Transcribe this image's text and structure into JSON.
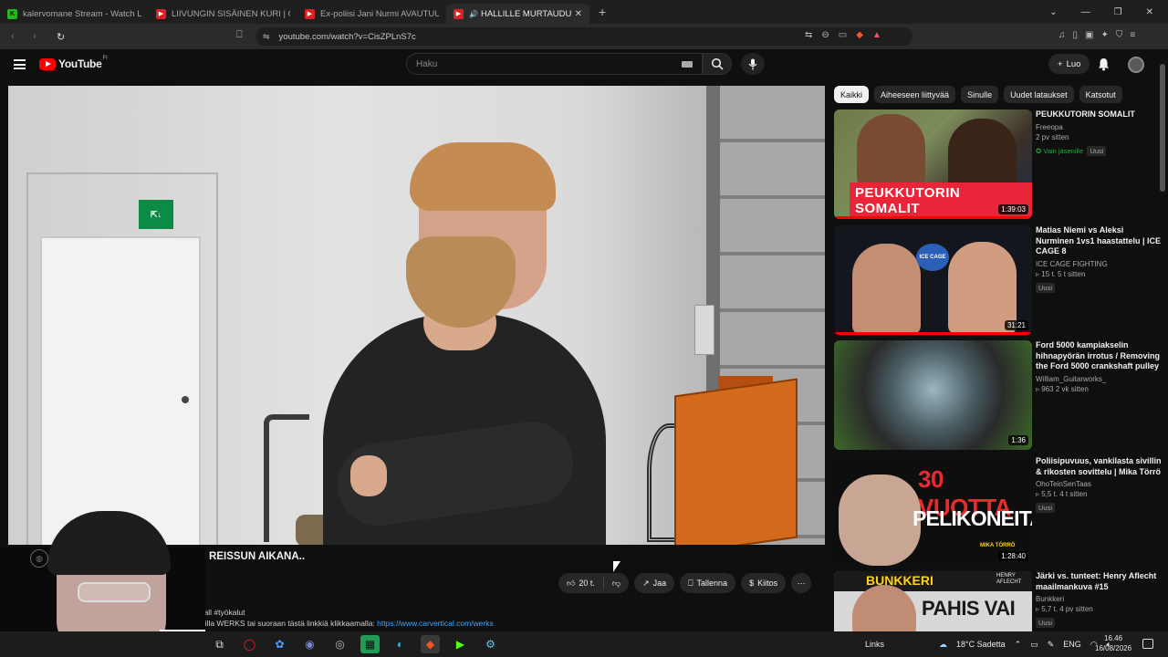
{
  "browser": {
    "tabs": [
      {
        "title": "kalervomane Stream - Watch Live on",
        "favicon": "kick"
      },
      {
        "title": "LIIVUNGIN SISÄINEN KURI | CANNO",
        "favicon": "youtube"
      },
      {
        "title": "Ex-poliisi Jani Nurmi AVAUTUU rikolli",
        "favicon": "youtube"
      },
      {
        "title": "HALLILLE MURTAUDUTTIIN I",
        "favicon": "youtube",
        "active": true,
        "audio": "speaker-icon"
      }
    ],
    "url": "youtube.com/watch?v=CisZPLnS7c"
  },
  "youtube": {
    "logo": "YouTube",
    "country": "FI",
    "search_placeholder": "Haku",
    "create_label": "Luo",
    "video_title": "..LANNIN REISSUN AIKANA..",
    "actions": {
      "likes": "20 t.",
      "share": "Jaa",
      "save": "Tallenna",
      "thanks": "Kiitos"
    },
    "description_line1": "aelWerka #hall #työkalut",
    "description_line2": "orteista koodilla WERKS tai suoraan tästä linkkiä klikkaamalla: ",
    "description_link": "https://www.carvertical.com/werks"
  },
  "chips": [
    "Kaikki",
    "Aiheeseen liittyvää",
    "Sinulle",
    "Uudet lataukset",
    "Katsotut"
  ],
  "recommendations": [
    {
      "title": "PEUKKUTORIN SOMALIT",
      "channel": "Freeopa",
      "views": "2 pv sitten",
      "members": "Vain jäsenille",
      "badge": "Uusi",
      "duration": "1:39:03",
      "thumb_text": "PEUKKUTORIN SOMALIT",
      "progress": 1.0
    },
    {
      "title": "Matias Niemi vs Aleksi Nurminen 1vs1 haastattelu | ICE CAGE 8",
      "channel": "ICE CAGE FIGHTING",
      "views": "15 t.  5 t sitten",
      "badge": "Uusi",
      "duration": "31:21",
      "thumb_text": "ICE CAGE",
      "progress": 1.0
    },
    {
      "title": "Ford 5000 kampiakselin hihnapyörän irrotus / Removing the Ford 5000 crankshaft pulley",
      "channel": "William_Guitarworks_",
      "views": "963  2 vk sitten",
      "duration": "1:36"
    },
    {
      "title": "Poliisipuvuus, vankilasta sivillin & rikosten sovittelu | Mika Törrö",
      "channel": "OhoTeinSenTaas",
      "views": "5,5 t.  4 t sitten",
      "badge": "Uusi",
      "duration": "1:28:40",
      "thumb_text_1": "30 VUOTTA",
      "thumb_text_2": "PELIKONEITA",
      "thumb_sub": "MIKA TÖRRÖ"
    },
    {
      "title": "Järki vs. tunteet: Henry Aflecht maailmankuva #15",
      "channel": "Bunkkeri",
      "views": "5,7 t.  4 pv sitten",
      "badge": "Uusi",
      "thumb_text_1": "BUNKKERI",
      "thumb_text_2": "PAHIS VAI",
      "thumb_sub": "HENRY AFLECHT"
    }
  ],
  "taskbar": {
    "links": "Links",
    "weather": "18°C  Sadetta",
    "lang": "ENG",
    "time": "16.46",
    "date": "16/08/2026"
  },
  "colors": {
    "youtube_red": "#ff0000",
    "link_blue": "#3ea6ff",
    "members_green": "#2ba640"
  }
}
